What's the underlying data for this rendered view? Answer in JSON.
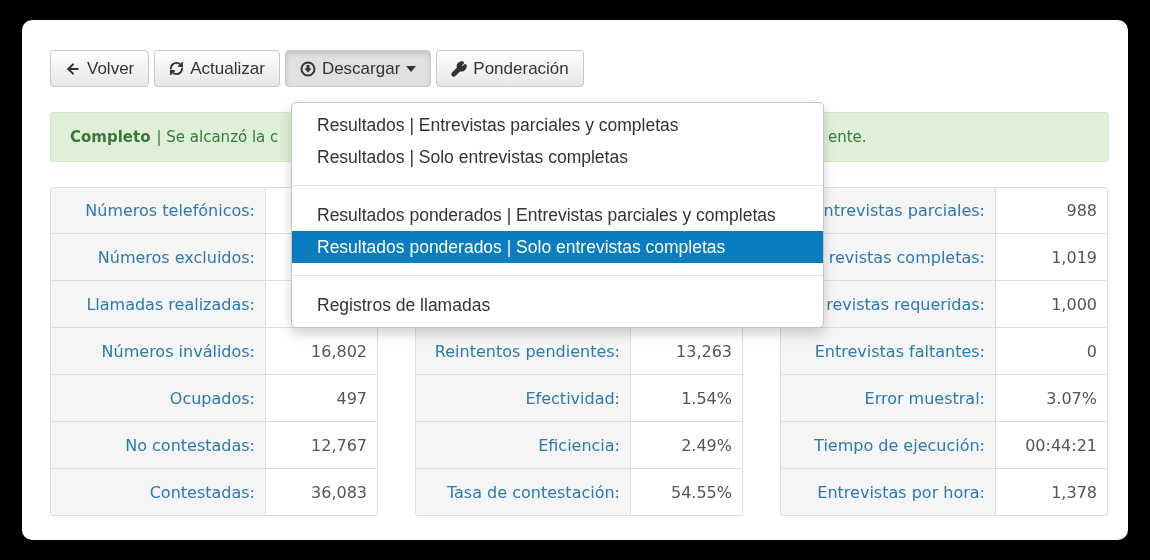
{
  "toolbar": {
    "buttons": [
      {
        "kind": "back",
        "label": "Volver",
        "active": false
      },
      {
        "kind": "refresh",
        "label": "Actualizar",
        "active": false
      },
      {
        "kind": "download",
        "label": "Descargar",
        "active": true,
        "caret": true
      },
      {
        "kind": "weight",
        "label": "Ponderación",
        "active": false
      }
    ]
  },
  "download_menu": {
    "groups": [
      [
        {
          "label": "Resultados | Entrevistas parciales y completas",
          "selected": false
        },
        {
          "label": "Resultados | Solo entrevistas completas",
          "selected": false
        }
      ],
      [
        {
          "label": "Resultados ponderados | Entrevistas parciales y completas",
          "selected": false
        },
        {
          "label": "Resultados ponderados | Solo entrevistas completas",
          "selected": true
        }
      ],
      [
        {
          "label": "Registros de llamadas",
          "selected": false
        }
      ]
    ]
  },
  "alert": {
    "title": "Completo",
    "text_start": "| Se alcanzó la c",
    "text_end": "ente."
  },
  "tables": [
    {
      "rows": [
        {
          "label": "Números telefónicos:"
        },
        {
          "label": "Números excluidos:"
        },
        {
          "label": "Llamadas realizadas:"
        },
        {
          "label": "Números inválidos:",
          "value": "16,802"
        },
        {
          "label": "Ocupados:",
          "value": "497"
        },
        {
          "label": "No contestadas:",
          "value": "12,767"
        },
        {
          "label": "Contestadas:",
          "value": "36,083"
        }
      ]
    },
    {
      "rows": [
        {
          "label": "Reintentos pendientes:",
          "value": "13,263"
        },
        {
          "label": "Efectividad:",
          "value": "1.54%"
        },
        {
          "label": "Eficiencia:",
          "value": "2.49%"
        },
        {
          "label": "Tasa de contestación:",
          "value": "54.55%"
        }
      ]
    },
    {
      "rows": [
        {
          "label": "ntrevistas parciales:",
          "value": "988"
        },
        {
          "label": "revistas completas:",
          "value": "1,019"
        },
        {
          "label": "revistas requeridas:",
          "value": "1,000"
        },
        {
          "label": "Entrevistas faltantes:",
          "value": "0"
        },
        {
          "label": "Error muestral:",
          "value": "3.07%"
        },
        {
          "label": "Tiempo de ejecución:",
          "value": "00:44:21"
        },
        {
          "label": "Entrevistas por hora:",
          "value": "1,378"
        }
      ]
    }
  ]
}
